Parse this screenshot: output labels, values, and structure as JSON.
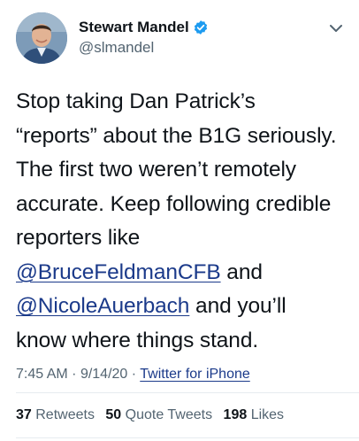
{
  "author": {
    "display_name": "Stewart Mandel",
    "handle": "@slmandel",
    "verified": true,
    "avatar_icon": "profile-photo"
  },
  "tweet": {
    "lines": [
      [
        {
          "type": "text",
          "text": "Stop taking Dan Patrick’s"
        }
      ],
      [
        {
          "type": "text",
          "text": "“reports” about the B1G seriously."
        }
      ],
      [
        {
          "type": "text",
          "text": "The first two weren’t remotely"
        }
      ],
      [
        {
          "type": "text",
          "text": "accurate. Keep following credible"
        }
      ],
      [
        {
          "type": "text",
          "text": "reporters like"
        }
      ],
      [
        {
          "type": "mention",
          "text": "@BruceFeldmanCFB"
        },
        {
          "type": "text",
          "text": " and"
        }
      ],
      [
        {
          "type": "mention",
          "text": "@NicoleAuerbach"
        },
        {
          "type": "text",
          "text": " and you’ll"
        }
      ],
      [
        {
          "type": "text",
          "text": "know where things stand."
        }
      ]
    ]
  },
  "meta": {
    "time": "7:45 AM",
    "separator": "·",
    "date": "9/14/20",
    "source": "Twitter for iPhone"
  },
  "stats": {
    "retweets_count": "37",
    "retweets_label": "Retweets",
    "quotes_count": "50",
    "quotes_label": "Quote Tweets",
    "likes_count": "198",
    "likes_label": "Likes"
  },
  "colors": {
    "link": "#1b3a8a",
    "verified": "#1d9bf0",
    "secondary_text": "#536471"
  },
  "icons": {
    "verified": "verified-badge-icon",
    "menu": "chevron-down-icon"
  }
}
